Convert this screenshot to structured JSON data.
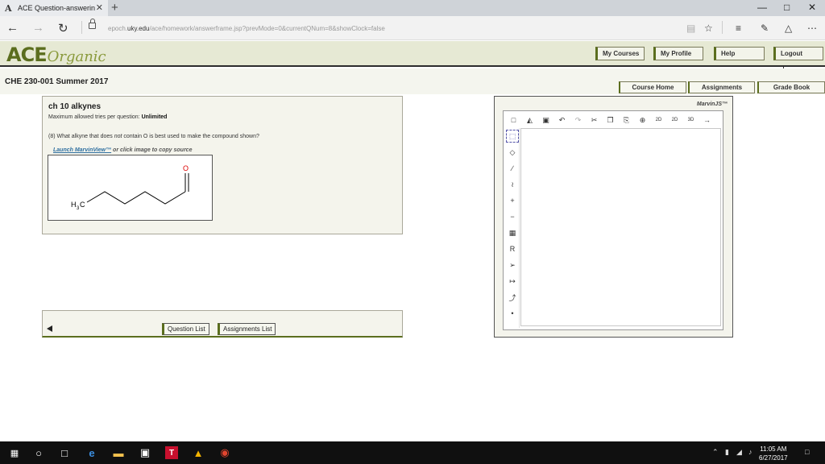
{
  "browser": {
    "tab_title": "ACE Question-answerin",
    "tab_close": "✕",
    "new_tab": "+",
    "url_prefix": "epoch.",
    "url_host": "uky.edu",
    "url_path": "/ace/homework/answerframe.jsp?prevMode=0&currentQNum=8&showClock=false"
  },
  "site": {
    "logo_main": "ACE",
    "logo_sub": "Organic",
    "top_nav": [
      "My Courses",
      "My Profile",
      "Help",
      "Logout"
    ],
    "course_title": "CHE 230-001 Summer 2017",
    "tabs": [
      "Course Home",
      "Assignments",
      "Grade Book"
    ]
  },
  "question": {
    "title": "ch 10 alkynes",
    "tries_label": "Maximum allowed tries per question:",
    "tries_value": "Unlimited",
    "text_before": "(8) What alkyne that does ",
    "text_not": "not",
    "text_after": " contain O is best used to make the compound shown?",
    "launch_link": "Launch MarvinView™",
    "launch_suffix": " or click image to copy source",
    "molecule": {
      "left_label": "H",
      "left_sub": "3",
      "left_label_c": "C",
      "top_label": "O"
    }
  },
  "nav": {
    "question_list": "Question List",
    "assignments_list": "Assignments List"
  },
  "marvin": {
    "title": "MarvinJS™"
  },
  "taskbar": {
    "time": "11:05 AM",
    "date": "6/27/2017"
  },
  "colors": {
    "accent": "#5b6e1e",
    "header_bg": "#e6e9d4",
    "panel_bg": "#f4f4ec"
  }
}
